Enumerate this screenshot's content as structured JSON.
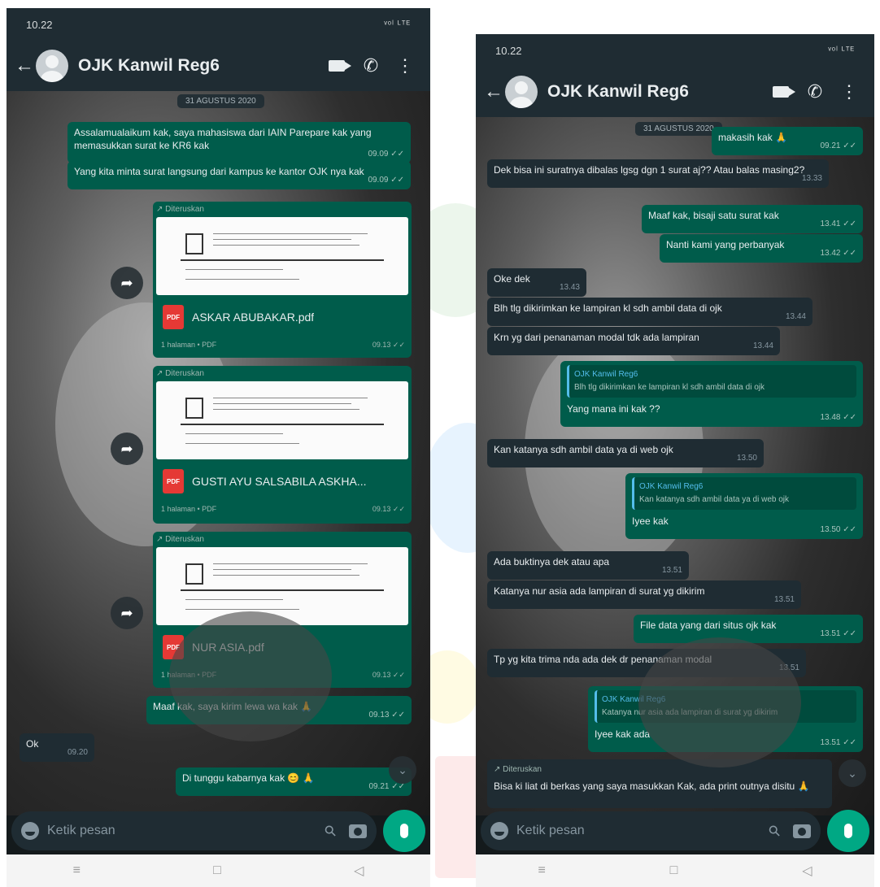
{
  "status": {
    "time": "10.22",
    "signal": "ᵛᵒˡ ᴸᵀᴱ"
  },
  "header": {
    "contact": "OJK Kanwil Reg6"
  },
  "date_chip": "31 AGUSTUS 2020",
  "icons": {
    "back": "back-arrow-icon",
    "avatar": "avatar-icon",
    "video": "video-call-icon",
    "call": "phone-icon",
    "menu": "more-options-icon",
    "emoji": "emoji-icon",
    "attach": "attach-icon",
    "camera": "camera-icon",
    "mic": "mic-icon"
  },
  "input": {
    "placeholder": "Ketik pesan"
  },
  "nav": {
    "menu": "≡",
    "home": "□",
    "back": "◁"
  },
  "left_chat": {
    "messages": [
      {
        "text": "Assalamualaikum kak, saya mahasiswa dari IAIN Parepare kak yang memasukkan surat ke KR6 kak",
        "time": "09.09 ✓✓"
      },
      {
        "text": "Yang kita minta surat langsung dari kampus ke kantor OJK nya kak",
        "time": "09.09 ✓✓"
      }
    ],
    "documents": [
      {
        "forwarded": "↗ Diteruskan",
        "name": "ASKAR ABUBAKAR.pdf",
        "meta": "1 halaman • PDF",
        "time": "09.13 ✓✓"
      },
      {
        "forwarded": "↗ Diteruskan",
        "name": "GUSTI AYU SALSABILA ASKHA...",
        "meta": "1 halaman • PDF",
        "time": "09.13 ✓✓"
      },
      {
        "forwarded": "↗ Diteruskan",
        "name": "NUR ASIA.pdf",
        "meta": "1 halaman • PDF",
        "time": "09.13 ✓✓"
      }
    ],
    "pdf_label": "PDF",
    "after": [
      {
        "text": "Maaf kak, saya kirim lewa wa kak 🙏",
        "time": "09.13 ✓✓"
      },
      {
        "text": "Ok",
        "time": "09.20"
      },
      {
        "text": "Di tunggu kabarnya kak 😊 🙏",
        "time": "09.21 ✓✓"
      }
    ]
  },
  "right_chat": {
    "messages": [
      {
        "text": "makasih kak 🙏",
        "time": "09.21 ✓✓"
      },
      {
        "text": "Dek bisa ini suratnya dibalas lgsg dgn 1 surat aj?? Atau balas masing2?",
        "time": "13.33"
      },
      {
        "text": "Maaf kak, bisaji satu surat kak",
        "time": "13.41 ✓✓"
      },
      {
        "text": "Nanti kami yang perbanyak",
        "time": "13.42 ✓✓"
      },
      {
        "text": "Oke dek",
        "time": "13.43"
      },
      {
        "text": "Blh tlg dikirimkan ke lampiran kl sdh ambil data di ojk",
        "time": "13.44"
      },
      {
        "text": "Krn yg dari penanaman modal tdk ada lampiran",
        "time": "13.44"
      },
      {
        "quote_name": "OJK Kanwil Reg6",
        "quote_text": "Blh tlg dikirimkan ke lampiran kl sdh ambil data di ojk",
        "text": "Yang mana ini kak ??",
        "time": "13.48 ✓✓"
      },
      {
        "text": "Kan katanya sdh ambil data ya di web ojk",
        "time": "13.50"
      },
      {
        "quote_name": "OJK Kanwil Reg6",
        "quote_text": "Kan katanya sdh ambil data ya di web ojk",
        "text": "Iyee kak",
        "time": "13.50 ✓✓"
      },
      {
        "text": "Ada buktinya dek atau apa",
        "time": "13.51"
      },
      {
        "text": "Katanya nur asia ada lampiran di surat yg dikirim",
        "time": "13.51"
      },
      {
        "text": "File data yang dari situs ojk kak",
        "time": "13.51 ✓✓"
      },
      {
        "text": "Tp yg kita trima nda ada dek dr penanaman modal",
        "time": "13.51"
      },
      {
        "quote_name": "OJK Kanwil Reg6",
        "quote_text": "Katanya nur asia ada lampiran di surat yg dikirim",
        "text": "Iyee kak ada",
        "time": "13.51 ✓✓"
      },
      {
        "forwarded": "↗ Diteruskan",
        "text": "Bisa ki liat di berkas yang saya masukkan Kak, ada print outnya disitu 🙏",
        "time": ""
      }
    ]
  }
}
